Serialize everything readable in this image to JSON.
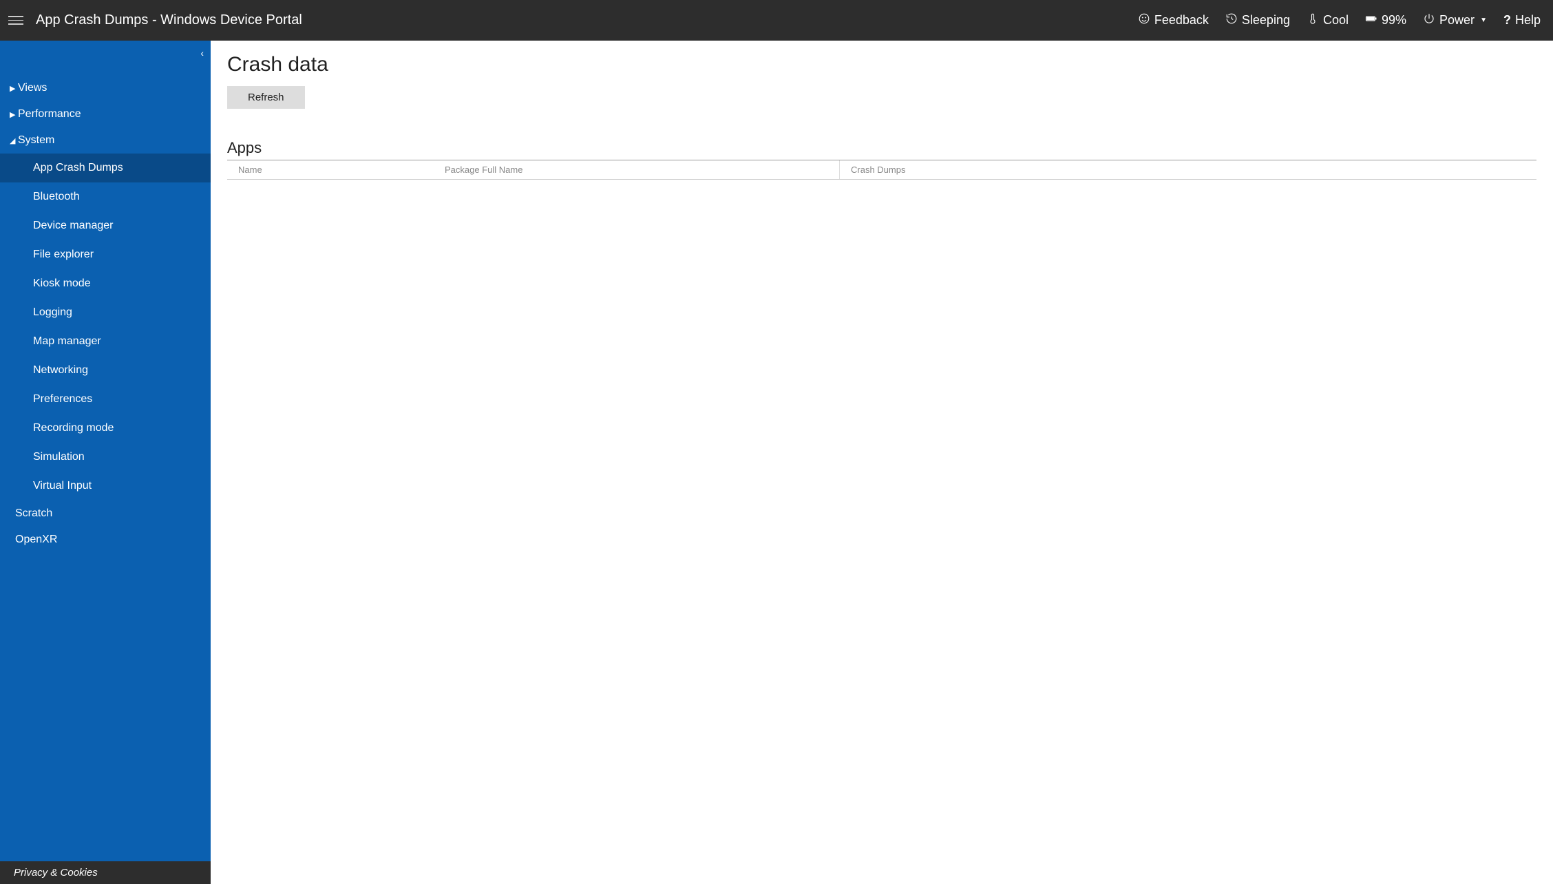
{
  "header": {
    "title": "App Crash Dumps - Windows Device Portal",
    "feedback": "Feedback",
    "sleeping": "Sleeping",
    "cool": "Cool",
    "battery": "99%",
    "power": "Power",
    "help": "Help"
  },
  "sidebar": {
    "views": "Views",
    "performance": "Performance",
    "system": "System",
    "system_items": {
      "app_crash_dumps": "App Crash Dumps",
      "bluetooth": "Bluetooth",
      "device_manager": "Device manager",
      "file_explorer": "File explorer",
      "kiosk_mode": "Kiosk mode",
      "logging": "Logging",
      "map_manager": "Map manager",
      "networking": "Networking",
      "preferences": "Preferences",
      "recording_mode": "Recording mode",
      "simulation": "Simulation",
      "virtual_input": "Virtual Input"
    },
    "scratch": "Scratch",
    "openxr": "OpenXR",
    "footer": "Privacy & Cookies"
  },
  "main": {
    "title": "Crash data",
    "refresh": "Refresh",
    "apps_heading": "Apps",
    "columns": {
      "name": "Name",
      "package": "Package Full Name",
      "crash": "Crash Dumps"
    }
  }
}
